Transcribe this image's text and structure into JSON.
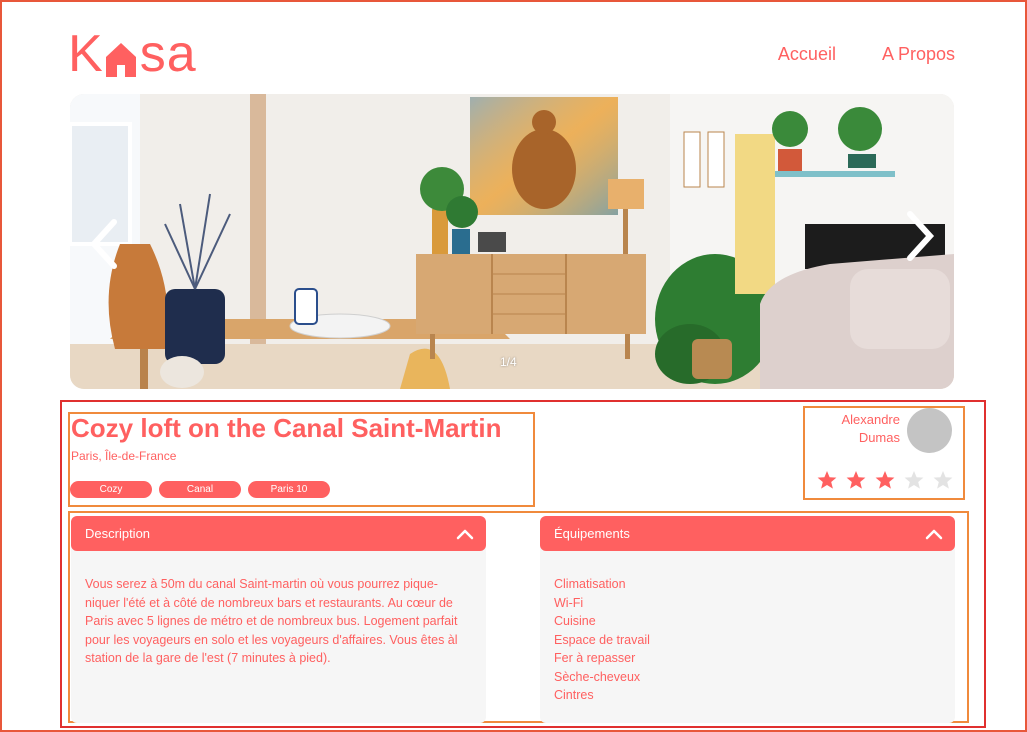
{
  "header": {
    "logo_text_left": "K",
    "logo_text_right": "sa",
    "nav": [
      {
        "label": "Accueil"
      },
      {
        "label": "A Propos"
      }
    ]
  },
  "carousel": {
    "counter": "1/4",
    "current": 1,
    "total": 4
  },
  "listing": {
    "title": "Cozy loft on the Canal Saint-Martin",
    "location": "Paris, Île-de-France",
    "tags": [
      "Cozy",
      "Canal",
      "Paris 10"
    ]
  },
  "host": {
    "first_name": "Alexandre",
    "last_name": "Dumas",
    "rating": 3,
    "rating_max": 5
  },
  "description": {
    "header": "Description",
    "text": "Vous serez à 50m du canal Saint-martin où vous pourrez pique-niquer l'été et à côté de nombreux bars et restaurants. Au cœur de Paris avec 5 lignes de métro et de nombreux bus. Logement parfait pour les voyageurs en solo et les voyageurs d'affaires. Vous êtes àl station de la gare de l'est (7 minutes à pied)."
  },
  "equipments": {
    "header": "Équipements",
    "items": [
      "Climatisation",
      "Wi-Fi",
      "Cuisine",
      "Espace de travail",
      "Fer à repasser",
      "Sèche-cheveux",
      "Cintres"
    ]
  },
  "colors": {
    "brand": "#ff6060",
    "star_active": "#ff6060",
    "star_inactive": "#e3e3e3",
    "panel_bg": "#f6f6f6",
    "annotation_red": "#e0302f",
    "annotation_orange": "#f08a3c"
  },
  "icons": {
    "logo": "house-icon",
    "prev": "chevron-left-icon",
    "next": "chevron-right-icon",
    "collapse": "chevron-up-icon",
    "rating": "star-icon"
  }
}
